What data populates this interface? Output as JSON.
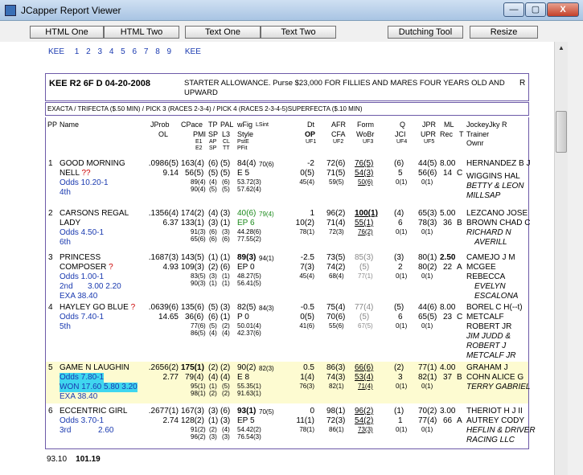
{
  "window": {
    "title": "JCapper Report Viewer",
    "min_symbol": "—",
    "max_symbol": "▢",
    "close_symbol": "X"
  },
  "toolbar": {
    "html_one": "HTML One",
    "html_two": "HTML Two",
    "text_one": "Text One",
    "text_two": "Text Two",
    "dutching_tool": "Dutching Tool",
    "resize": "Resize"
  },
  "track_nav": {
    "track": "KEE",
    "races": [
      "1",
      "2",
      "3",
      "4",
      "5",
      "6",
      "7",
      "8",
      "9"
    ],
    "track_end": "KEE"
  },
  "race": {
    "key": "KEE R2 6F D 04-20-2008",
    "description": "STARTER ALLOWANCE. Purse $23,000 FOR FILLIES AND MARES FOUR YEARS OLD AND UPWARD",
    "grade": "R",
    "wagers": "EXACTA / TRIFECTA ($.50 MIN) / PICK 3 (RACES 2-3-4) / PICK 4 (RACES 2-3-4-5)SUPERFECTA ($.10 MIN)"
  },
  "headers": {
    "pp": "PP",
    "name": "Name",
    "jprob": "JProb",
    "ol": "OL",
    "cpace": "CPace",
    "tp": "TP",
    "pal": "PAL",
    "pmi": "PMI",
    "sp": "SP",
    "l3": "L3",
    "e1": "E1",
    "ap": "AP",
    "cl": "CL",
    "e2": "E2",
    "sp2": "SP",
    "tt": "TT",
    "wfig": "wFig",
    "lsint": "LSint",
    "style": "Style",
    "pste": "PstE",
    "pfit": "PFit",
    "dt": "Dt",
    "op": "OP",
    "uf1": "UF1",
    "afr": "AFR",
    "cfa": "CFA",
    "uf2": "UF2",
    "form": "Form",
    "wobr": "WoBr",
    "uf3": "UF3",
    "q": "Q",
    "jci": "JCI",
    "uf4": "UF4",
    "jpr": "JPR",
    "upr": "UPR",
    "uf5": "UF5",
    "ml": "ML",
    "rec": "Rec",
    "t": "T",
    "jockey": "JockeyJky R",
    "trainer": "Trainer",
    "owner": "Ownr"
  },
  "horses": [
    {
      "pp": "1",
      "name1": "GOOD MORNING",
      "name2": "NELL",
      "mark": "??",
      "odds": "Odds 10.20-1",
      "finish": "4th",
      "payout": "",
      "exa": "",
      "jprob": ".0986(5)",
      "ol": "9.14",
      "cpace": "163(4)",
      "tp": "(6)",
      "pal": "(5)",
      "pmi": "56(5)",
      "sp": "(5)",
      "l3": "(5)",
      "e1": "89(4)",
      "ap": "(4)",
      "cl": "(6)",
      "e2": "90(4)",
      "sp2": "(5)",
      "tt": "(5)",
      "wfig": "84(4)",
      "lsint": "70(6)",
      "style": "E 5",
      "pste": "53.72(3)",
      "pfit": "57.62(4)",
      "dt": "-2",
      "op": "0(5)",
      "uf1": "45(4)",
      "afr": "72(6)",
      "cfa": "71(5)",
      "uf2": "59(5)",
      "form": "76(5)",
      "wobr": "54(3)",
      "uf3": "50(6)",
      "q": "(6)",
      "jci": "5",
      "uf4": "0(1)",
      "jpr": "44(5)",
      "upr": "56(6)",
      "uf5": "0(1)",
      "ml": "8.00",
      "rec": "14",
      "t": "C",
      "jockey": "HERNANDEZ B J",
      "trainer": "WIGGINS HAL",
      "owner1": "BETTY & LEON",
      "owner2": "MILLSAP"
    },
    {
      "pp": "2",
      "name1": "CARSONS REGAL",
      "name2": "LADY",
      "mark": "",
      "odds": "Odds 4.50-1",
      "finish": "6th",
      "payout": "",
      "exa": "",
      "jprob": ".1356(4)",
      "ol": "6.37",
      "cpace": "174(2)",
      "tp": "(4)",
      "pal": "(3)",
      "pmi": "133(1)",
      "sp": "(3)",
      "l3": "(1)",
      "e1": "91(3)",
      "ap": "(6)",
      "cl": "(3)",
      "e2": "65(6)",
      "sp2": "(6)",
      "tt": "(6)",
      "wfig": "40(6)",
      "lsint": "79(4)",
      "style": "EP 6",
      "pste": "44.28(6)",
      "pfit": "77.55(2)",
      "dt": "1",
      "op": "10(2)",
      "uf1": "78(1)",
      "afr": "96(2)",
      "cfa": "71(4)",
      "uf2": "72(3)",
      "form": "100(1)",
      "wobr": "55(1)",
      "uf3": "76(2)",
      "q": "(4)",
      "jci": "6",
      "uf4": "0(1)",
      "jpr": "65(3)",
      "upr": "78(3)",
      "uf5": "0(1)",
      "ml": "5.00",
      "rec": "36",
      "t": "B",
      "jockey": "LEZCANO JOSE",
      "trainer": "BROWN CHAD C",
      "owner1": "RICHARD N",
      "owner2": "AVERILL"
    },
    {
      "pp": "3",
      "name1": "PRINCESS",
      "name2": "COMPOSER",
      "mark": "?",
      "odds": "Odds 1.00-1",
      "finish": "2nd",
      "payout": "3.00 2.20",
      "exa": "EXA 38.40",
      "jprob": ".1687(3)",
      "ol": "4.93",
      "cpace": "143(5)",
      "tp": "(1)",
      "pal": "(1)",
      "pmi": "109(3)",
      "sp": "(2)",
      "l3": "(6)",
      "e1": "83(5)",
      "ap": "(3)",
      "cl": "(1)",
      "e2": "90(3)",
      "sp2": "(1)",
      "tt": "(1)",
      "wfig": "89(3)",
      "lsint": "94(1)",
      "style": "EP 0",
      "pste": "48.27(5)",
      "pfit": "56.41(5)",
      "dt": "-2.5",
      "op": "7(3)",
      "uf1": "45(4)",
      "afr": "73(5)",
      "cfa": "74(2)",
      "uf2": "68(4)",
      "form": "85(3)",
      "wobr": "(5)",
      "uf3": "77(1)",
      "q": "(3)",
      "jci": "2",
      "uf4": "0(1)",
      "jpr": "80(1)",
      "upr": "80(2)",
      "uf5": "0(1)",
      "ml": "2.50",
      "rec": "22",
      "t": "A",
      "jockey": "CAMEJO J M",
      "trainer": "MCGEE",
      "trainer2": "REBECCA",
      "owner1": "EVELYN",
      "owner2": "ESCALONA"
    },
    {
      "pp": "4",
      "name1": "HAYLEY GO BLUE",
      "name2": "",
      "mark": "?",
      "odds": "Odds 7.40-1",
      "finish": "5th",
      "payout": "",
      "exa": "",
      "jprob": ".0639(6)",
      "ol": "14.65",
      "cpace": "135(6)",
      "tp": "(5)",
      "pal": "(3)",
      "pmi": "36(6)",
      "sp": "(6)",
      "l3": "(1)",
      "e1": "77(6)",
      "ap": "(5)",
      "cl": "(2)",
      "e2": "86(5)",
      "sp2": "(4)",
      "tt": "(4)",
      "wfig": "82(5)",
      "lsint": "84(3)",
      "style": "P 0",
      "pste": "50.01(4)",
      "pfit": "42.37(6)",
      "dt": "-0.5",
      "op": "0(5)",
      "uf1": "41(6)",
      "afr": "75(4)",
      "cfa": "70(6)",
      "uf2": "55(6)",
      "form": "77(4)",
      "wobr": "(5)",
      "uf3": "67(5)",
      "q": "(5)",
      "jci": "6",
      "uf4": "0(1)",
      "jpr": "44(6)",
      "upr": "65(5)",
      "uf5": "0(1)",
      "ml": "8.00",
      "rec": "23",
      "t": "C",
      "jockey": "BOREL C H(--t)",
      "trainer": "METCALF",
      "trainer2": "ROBERT JR",
      "owner1": "JIM JUDD &",
      "owner2": "ROBERT J",
      "owner3": "METCALF JR"
    },
    {
      "pp": "5",
      "name1": "GAME N LAUGHIN",
      "name2": "",
      "mark": "",
      "odds": "Odds 7.80-1",
      "finish": "WON 17.60 5.80 3.20",
      "payout": "",
      "exa": "EXA 38.40",
      "jprob": ".2656(2)",
      "ol": "2.77",
      "cpace": "175(1)",
      "tp": "(2)",
      "pal": "(2)",
      "pmi": "79(4)",
      "sp": "(4)",
      "l3": "(4)",
      "e1": "95(1)",
      "ap": "(1)",
      "cl": "(5)",
      "e2": "98(1)",
      "sp2": "(2)",
      "tt": "(2)",
      "wfig": "90(2)",
      "lsint": "82(3)",
      "style": "E 8",
      "pste": "55.35(1)",
      "pfit": "91.63(1)",
      "dt": "0.5",
      "op": "1(4)",
      "uf1": "76(3)",
      "afr": "86(3)",
      "cfa": "74(3)",
      "uf2": "82(1)",
      "form": "66(6)",
      "wobr": "53(4)",
      "uf3": "71(4)",
      "q": "(2)",
      "jci": "3",
      "uf4": "0(1)",
      "jpr": "77(1)",
      "upr": "82(1)",
      "uf5": "0(1)",
      "ml": "4.00",
      "rec": "37",
      "t": "B",
      "jockey": "GRAHAM J",
      "trainer": "COHN ALICE G",
      "owner1": "TERRY GABRIEL",
      "owner2": ""
    },
    {
      "pp": "6",
      "name1": "ECCENTRIC GIRL",
      "name2": "",
      "mark": "",
      "odds": "Odds 3.70-1",
      "finish": "3rd",
      "payout": "2.60",
      "exa": "",
      "jprob": ".2677(1)",
      "ol": "2.74",
      "cpace": "167(3)",
      "tp": "(3)",
      "pal": "(6)",
      "pmi": "128(2)",
      "sp": "(1)",
      "l3": "(3)",
      "e1": "91(2)",
      "ap": "(2)",
      "cl": "(4)",
      "e2": "96(2)",
      "sp2": "(3)",
      "tt": "(3)",
      "wfig": "93(1)",
      "lsint": "70(5)",
      "style": "EP 5",
      "pste": "54.42(2)",
      "pfit": "76.54(3)",
      "dt": "0",
      "op": "11(1)",
      "uf1": "78(1)",
      "afr": "98(1)",
      "cfa": "72(3)",
      "uf2": "86(1)",
      "form": "96(2)",
      "wobr": "54(2)",
      "uf3": "73(3)",
      "q": "(1)",
      "jci": "1",
      "uf4": "0(1)",
      "jpr": "70(2)",
      "upr": "77(4)",
      "uf5": "0(1)",
      "ml": "3.00",
      "rec": "66",
      "t": "A",
      "jockey": "THERIOT H J II",
      "trainer": "AUTREY CODY",
      "owner1": "HEFLIN & DRIVER",
      "owner2": "RACING LLC"
    }
  ],
  "footer": {
    "value1": "93.10",
    "value2": "101.19"
  }
}
